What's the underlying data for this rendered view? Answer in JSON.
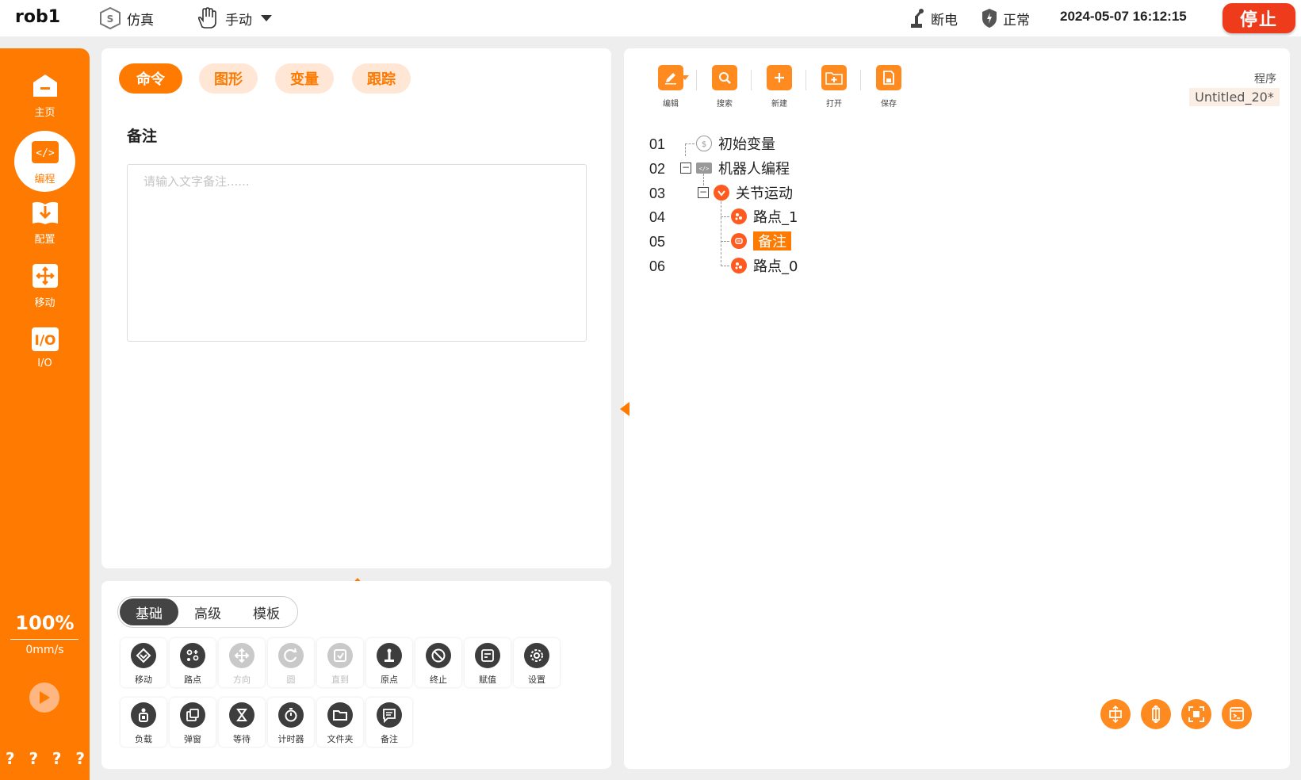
{
  "topbar": {
    "robot_name": "rob1",
    "mode_label": "仿真",
    "manual_label": "手动",
    "power_label": "断电",
    "safety_label": "正常",
    "datetime": "2024-05-07 16:12:15",
    "stop_label": "停止"
  },
  "sidebar": {
    "items": [
      {
        "label": "主页"
      },
      {
        "label": "编程"
      },
      {
        "label": "配置"
      },
      {
        "label": "移动"
      },
      {
        "label": "I/O"
      }
    ],
    "speed_percent": "100%",
    "speed_value": "0mm/s",
    "help": [
      "?",
      "?",
      "?",
      "?"
    ]
  },
  "editor": {
    "tabs": [
      {
        "label": "命令"
      },
      {
        "label": "图形"
      },
      {
        "label": "变量"
      },
      {
        "label": "跟踪"
      }
    ],
    "section_title": "备注",
    "note_value": "",
    "note_placeholder": "请输入文字备注......"
  },
  "palette": {
    "segments": [
      {
        "label": "基础"
      },
      {
        "label": "高级"
      },
      {
        "label": "模板"
      }
    ],
    "commands": [
      {
        "label": "移动",
        "icon": "move-shield-icon",
        "enabled": true
      },
      {
        "label": "路点",
        "icon": "waypoint-icon",
        "enabled": true
      },
      {
        "label": "方向",
        "icon": "direction-icon",
        "enabled": false
      },
      {
        "label": "圆",
        "icon": "circle-arrow-icon",
        "enabled": false
      },
      {
        "label": "直到",
        "icon": "until-icon",
        "enabled": false
      },
      {
        "label": "原点",
        "icon": "origin-icon",
        "enabled": true
      },
      {
        "label": "终止",
        "icon": "stop-circle-icon",
        "enabled": true
      },
      {
        "label": "赋值",
        "icon": "assign-icon",
        "enabled": true
      },
      {
        "label": "设置",
        "icon": "gear-icon",
        "enabled": true
      },
      {
        "label": "负载",
        "icon": "payload-icon",
        "enabled": true
      },
      {
        "label": "弹窗",
        "icon": "popup-icon",
        "enabled": true
      },
      {
        "label": "等待",
        "icon": "hourglass-icon",
        "enabled": true
      },
      {
        "label": "计时器",
        "icon": "stopwatch-icon",
        "enabled": true
      },
      {
        "label": "文件夹",
        "icon": "folder-icon",
        "enabled": true
      },
      {
        "label": "备注",
        "icon": "comment-icon",
        "enabled": true
      }
    ]
  },
  "program": {
    "toolbar": [
      {
        "label": "编辑"
      },
      {
        "label": "搜索"
      },
      {
        "label": "新建"
      },
      {
        "label": "打开"
      },
      {
        "label": "保存"
      }
    ],
    "program_label": "程序",
    "program_name": "Untitled_20*",
    "lines": [
      {
        "no": "01",
        "text": "初始变量"
      },
      {
        "no": "02",
        "text": "机器人编程"
      },
      {
        "no": "03",
        "text": "关节运动"
      },
      {
        "no": "04",
        "text": "路点_1"
      },
      {
        "no": "05",
        "text": "备注"
      },
      {
        "no": "06",
        "text": "路点_0"
      }
    ]
  },
  "colors": {
    "accent": "#ff7a00",
    "accent_light": "#ffe6d5",
    "stop": "#ee3b1c"
  }
}
